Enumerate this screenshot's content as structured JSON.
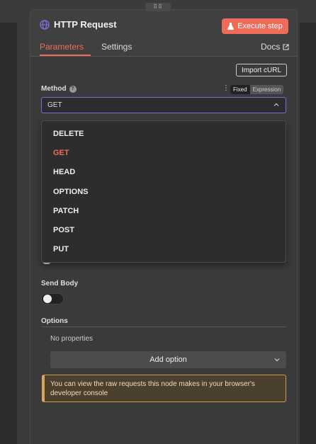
{
  "header": {
    "title": "HTTP Request",
    "execute_label": "Execute step",
    "tabs": [
      {
        "label": "Parameters",
        "active": true
      },
      {
        "label": "Settings",
        "active": false
      }
    ],
    "docs_label": "Docs"
  },
  "import_curl_label": "Import cURL",
  "method": {
    "label": "Method",
    "mode_options": [
      "Fixed",
      "Expression"
    ],
    "mode_selected": "Fixed",
    "value": "GET",
    "options": [
      "DELETE",
      "GET",
      "HEAD",
      "OPTIONS",
      "PATCH",
      "POST",
      "PUT"
    ],
    "selected": "GET"
  },
  "send_body": {
    "label": "Send Body",
    "enabled": false
  },
  "options": {
    "label": "Options",
    "empty_text": "No properties",
    "add_label": "Add option"
  },
  "notice": {
    "text": "You can view the raw requests this node makes in your browser's developer console"
  },
  "colors": {
    "accent": "#ee6c5a",
    "focus_border": "#7e6bd9",
    "notice_border": "#d7a55c"
  },
  "icons": {
    "node": "globe-icon",
    "execute": "flask-icon",
    "docs": "external-link-icon",
    "help": "question-icon",
    "select": "chevron-up-icon",
    "add": "chevron-down-icon",
    "menu": "kebab-icon"
  }
}
